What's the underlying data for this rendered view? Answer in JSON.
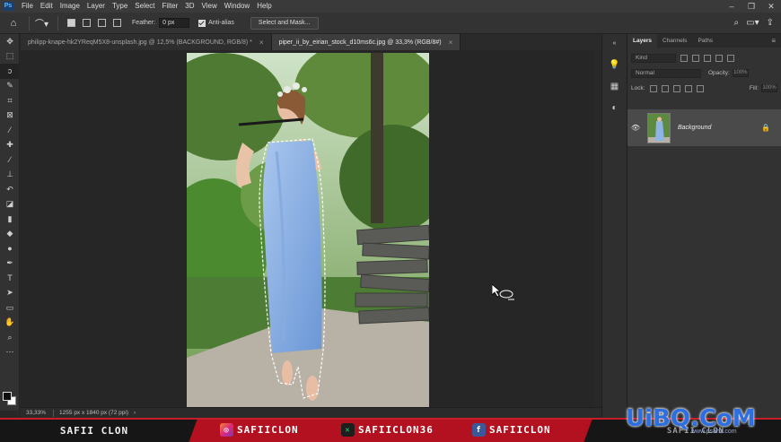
{
  "menubar": {
    "logo": "Ps",
    "items": [
      "File",
      "Edit",
      "Image",
      "Layer",
      "Type",
      "Select",
      "Filter",
      "3D",
      "View",
      "Window",
      "Help"
    ],
    "window_controls": [
      "–",
      "❐",
      "✕"
    ]
  },
  "options": {
    "feather_label": "Feather:",
    "feather_value": "0 px",
    "antialias_label": "Anti-alias",
    "select_mask_label": "Select and Mask..."
  },
  "tabs": [
    {
      "label": "philipp-knape-hk2YReqM5X8-unsplash.jpg @ 12,5% (BACKGROUND, RGB/8) *",
      "close": "×"
    },
    {
      "label": "piper_ii_by_eirian_stock_d10ms6c.jpg @ 33,3% (RGB/8#)",
      "close": "×"
    }
  ],
  "status": {
    "zoom": "33,33%",
    "doc_size": "1255 px x 1840 px (72 ppi)",
    "arrow": "›"
  },
  "layers_panel": {
    "tabs": [
      "Layers",
      "Channels",
      "Paths"
    ],
    "kind_placeholder": "Kind",
    "blend_mode": "Normal",
    "opacity_label": "Opacity:",
    "opacity_value": "100%",
    "lock_label": "Lock:",
    "fill_label": "Fill:",
    "fill_value": "100%",
    "layer_name": "Background"
  },
  "banner": {
    "name": "SAFII CLON",
    "instagram": "SAFIICLON",
    "x_handle": "SAFIICLON36",
    "facebook": "SAFIICLON",
    "right_name": "SAFII CLON"
  },
  "watermark": {
    "logo": "UiBQ.CoM",
    "sub": "www.psahz.com"
  },
  "colors": {
    "accent_red": "#c81e2c",
    "panel_bg": "#323232",
    "canvas_bg": "#262626"
  }
}
